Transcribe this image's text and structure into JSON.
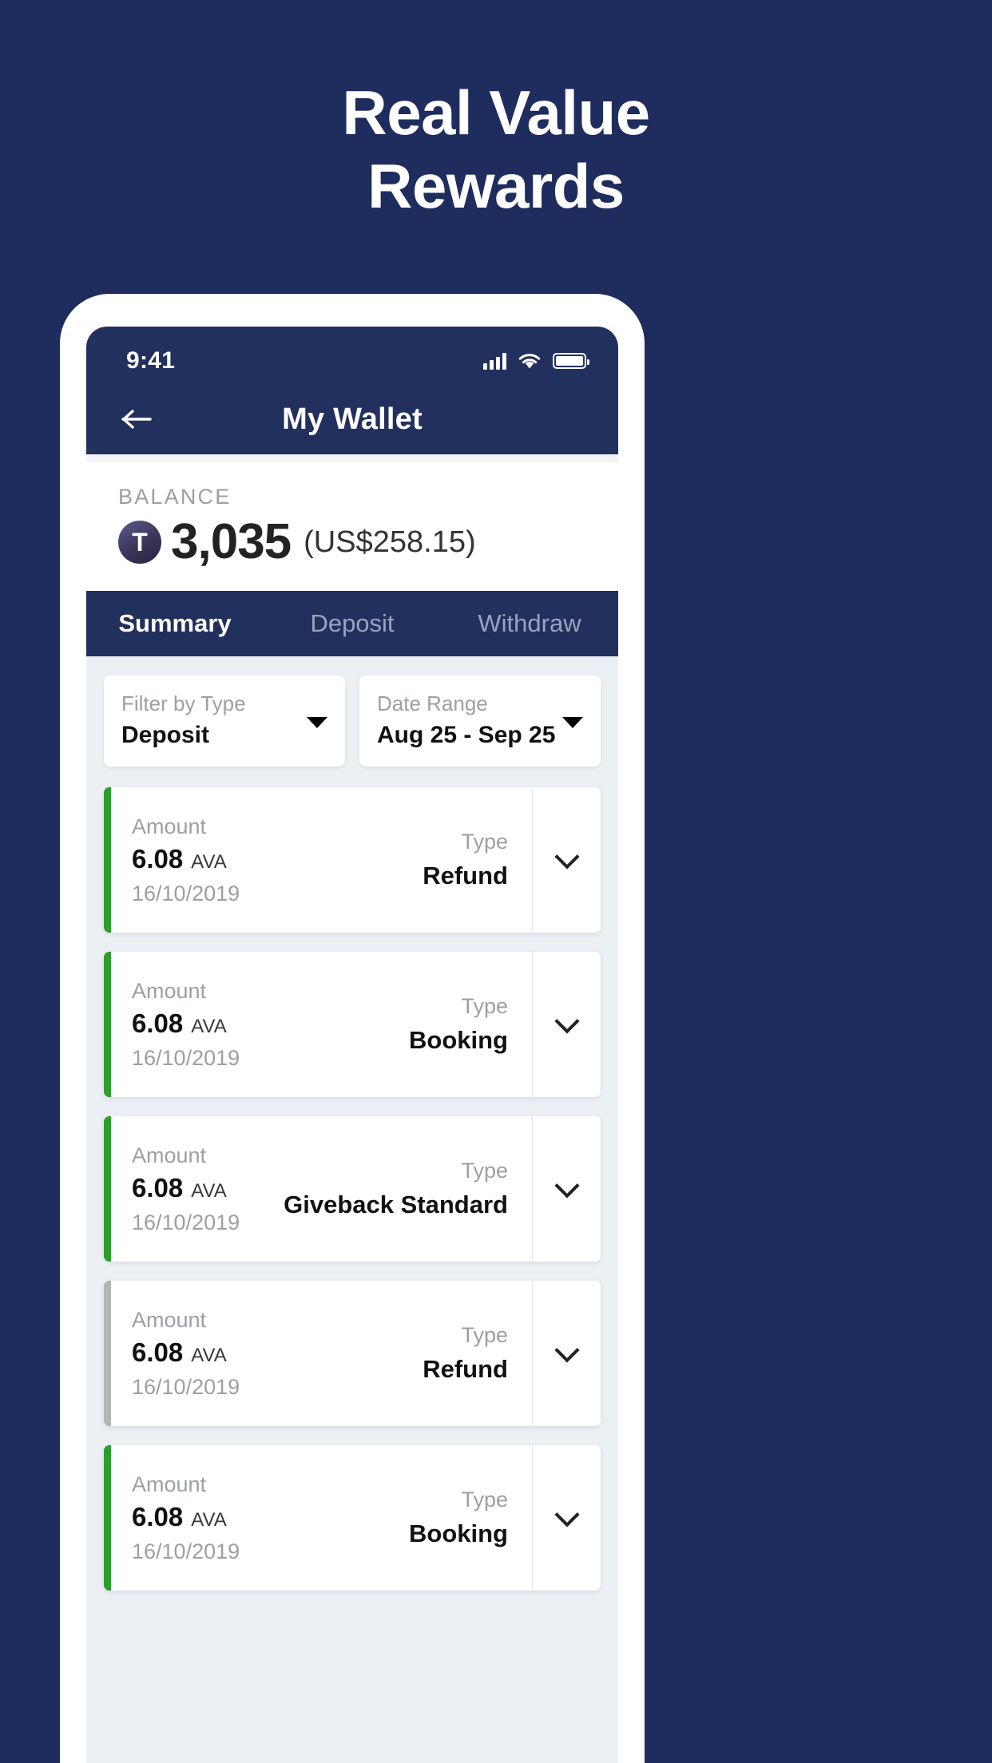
{
  "hero": {
    "line1": "Real Value",
    "line2": "Rewards"
  },
  "colors": {
    "background": "#1e2d5e",
    "header": "#22305e",
    "accent_green": "#2d9e2d",
    "accent_gray": "#b4b4b4",
    "body": "#eceff3"
  },
  "status_bar": {
    "time": "9:41",
    "signal_icon": "cellular-signal-icon",
    "wifi_icon": "wifi-icon",
    "battery_icon": "battery-icon"
  },
  "app_bar": {
    "back_icon": "back-arrow-icon",
    "title": "My Wallet"
  },
  "balance": {
    "label": "BALANCE",
    "token_symbol": "T",
    "amount": "3,035",
    "fiat": "(US$258.15)"
  },
  "tabs": [
    {
      "label": "Summary",
      "active": true
    },
    {
      "label": "Deposit",
      "active": false
    },
    {
      "label": "Withdraw",
      "active": false
    }
  ],
  "filters": [
    {
      "label": "Filter by Type",
      "value": "Deposit"
    },
    {
      "label": "Date Range",
      "value": "Aug 25 - Sep 25"
    }
  ],
  "transaction_labels": {
    "amount": "Amount",
    "type": "Type",
    "expand_icon": "chevron-down-icon"
  },
  "transactions": [
    {
      "amount": "6.08",
      "unit": "AVA",
      "date": "16/10/2019",
      "type": "Refund",
      "accent": "green"
    },
    {
      "amount": "6.08",
      "unit": "AVA",
      "date": "16/10/2019",
      "type": "Booking",
      "accent": "green"
    },
    {
      "amount": "6.08",
      "unit": "AVA",
      "date": "16/10/2019",
      "type": "Giveback Standard",
      "accent": "green"
    },
    {
      "amount": "6.08",
      "unit": "AVA",
      "date": "16/10/2019",
      "type": "Refund",
      "accent": "gray"
    },
    {
      "amount": "6.08",
      "unit": "AVA",
      "date": "16/10/2019",
      "type": "Booking",
      "accent": "green"
    }
  ]
}
